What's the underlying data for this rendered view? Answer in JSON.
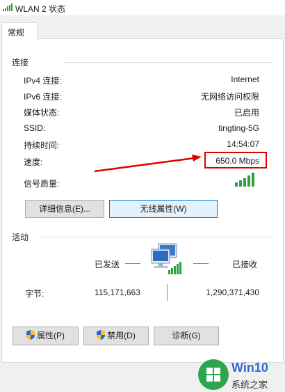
{
  "window": {
    "title": "WLAN 2 状态"
  },
  "tabs": [
    {
      "label": "常规"
    }
  ],
  "connection": {
    "section_label": "连接",
    "rows": [
      {
        "label": "IPv4 连接:",
        "value": "Internet"
      },
      {
        "label": "IPv6 连接:",
        "value": "无网络访问权限"
      },
      {
        "label": "媒体状态:",
        "value": "已启用"
      },
      {
        "label": "SSID:",
        "value": "tingting-5G"
      },
      {
        "label": "持续时间:",
        "value": "14:54:07"
      },
      {
        "label": "速度:",
        "value": "650.0 Mbps"
      }
    ],
    "signal_label": "信号质量:",
    "signal_bars_lit": 5,
    "signal_bars_total": 5
  },
  "buttons": {
    "details": "详细信息(E)...",
    "wireless_props": "无线属性(W)"
  },
  "activity": {
    "section_label": "活动",
    "sent_label": "已发送",
    "received_label": "已接收",
    "bytes_label": "字节:",
    "bytes_sent": "115,171,663",
    "bytes_received": "1,290,371,430"
  },
  "bottom_buttons": {
    "properties": "属性(P)",
    "disable": "禁用(D)",
    "diagnose": "诊断(G)"
  },
  "watermark": {
    "title": "Win10",
    "subtitle": "系统之家"
  },
  "colors": {
    "accent_blue": "#0078d7",
    "signal_green": "#2e9e3e",
    "annotation_red": "#e00000"
  }
}
